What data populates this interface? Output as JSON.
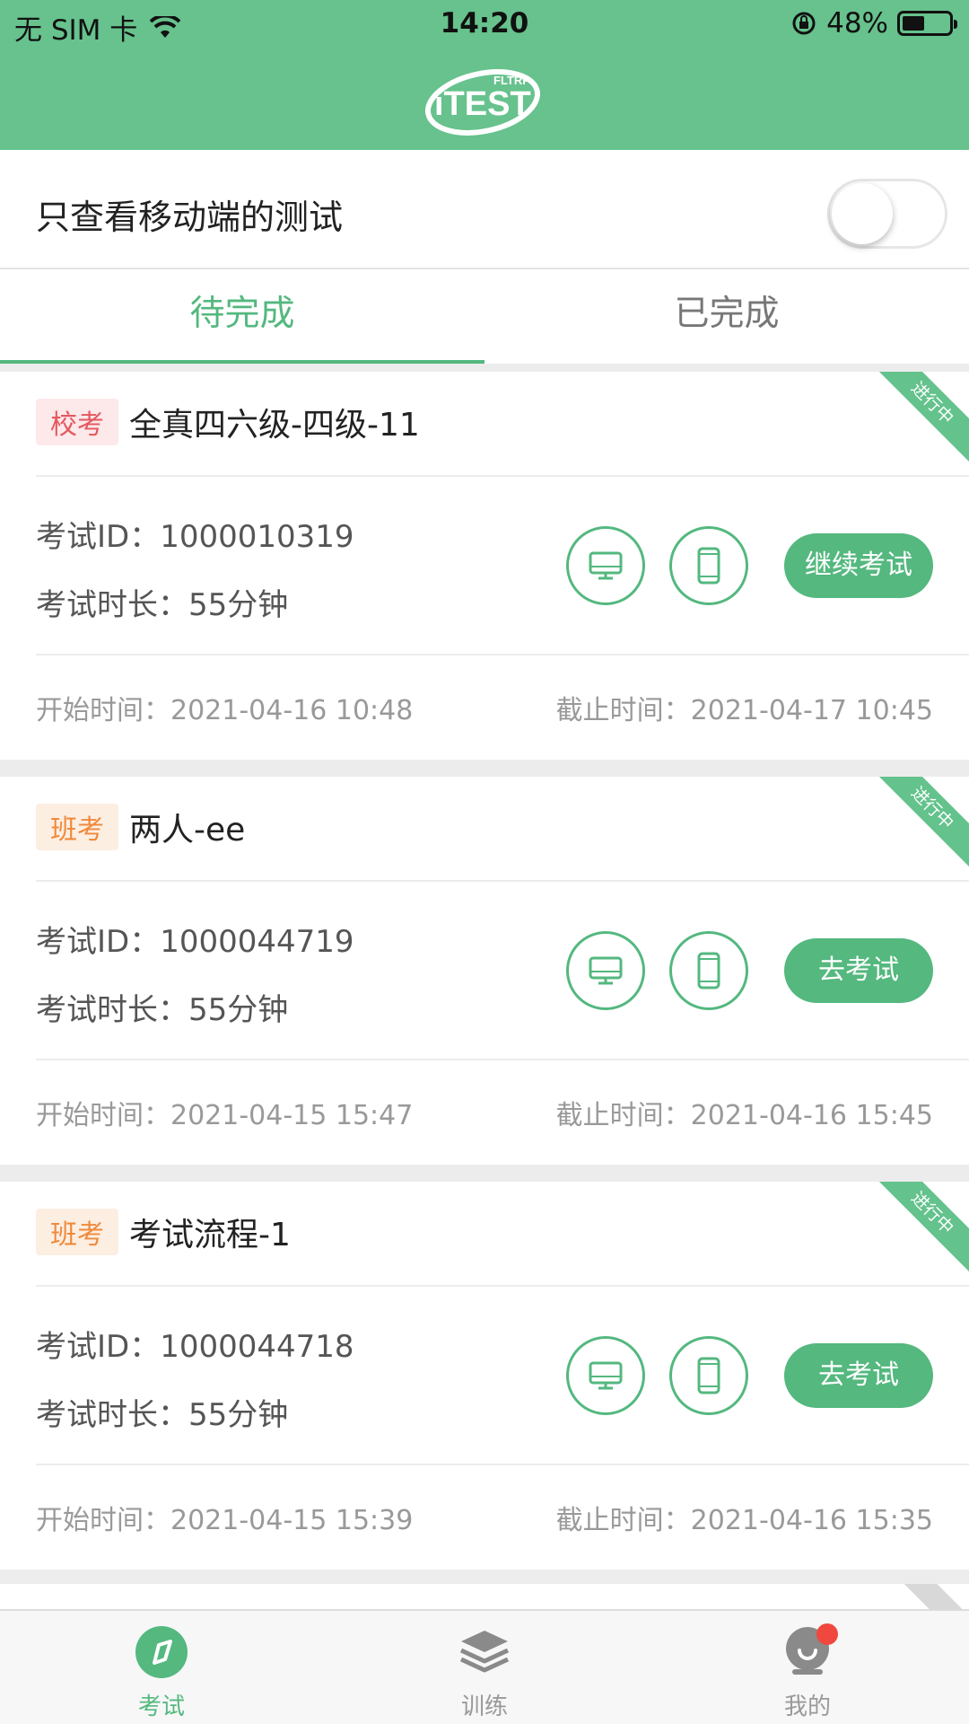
{
  "status_bar": {
    "carrier": "无 SIM 卡",
    "time": "14:20",
    "battery": "48%",
    "battery_level": 0.48,
    "icons": [
      "wifi-icon",
      "rotation-lock-icon",
      "battery-icon"
    ]
  },
  "header": {
    "logo_main": "iTEST",
    "logo_sub": "FLTRP",
    "background_color": "#67c28d"
  },
  "filter": {
    "label": "只查看移动端的测试",
    "toggle_on": false
  },
  "tabs": [
    {
      "label": "待完成",
      "active": true
    },
    {
      "label": "已完成",
      "active": false
    }
  ],
  "exams": [
    {
      "tag": "校考",
      "title": "全真四六级-四级-11",
      "status": "进行中",
      "id_line": "考试ID：1000010319",
      "duration_line": "考试时长：55分钟",
      "action": "继续考试",
      "start_line": "开始时间：2021-04-16 10:48",
      "end_line": "截止时间：2021-04-17 10:45"
    },
    {
      "tag": "班考",
      "title": "两人-ee",
      "status": "进行中",
      "id_line": "考试ID：1000044719",
      "duration_line": "考试时长：55分钟",
      "action": "去考试",
      "start_line": "开始时间：2021-04-15 15:47",
      "end_line": "截止时间：2021-04-16 15:45"
    },
    {
      "tag": "班考",
      "title": "考试流程-1",
      "status": "进行中",
      "id_line": "考试ID：1000044718",
      "duration_line": "考试时长：55分钟",
      "action": "去考试",
      "start_line": "开始时间：2021-04-15 15:39",
      "end_line": "截止时间：2021-04-16 15:35"
    }
  ],
  "bottom_nav": [
    {
      "label": "考试",
      "icon": "compass-icon",
      "active": true
    },
    {
      "label": "训练",
      "icon": "layers-icon",
      "active": false
    },
    {
      "label": "我的",
      "icon": "profile-icon",
      "active": false
    }
  ],
  "colors": {
    "primary": "#54b87f",
    "school_tag": "#e2595e",
    "class_tag": "#ef8a3c",
    "notification_dot": "#f0483e"
  }
}
